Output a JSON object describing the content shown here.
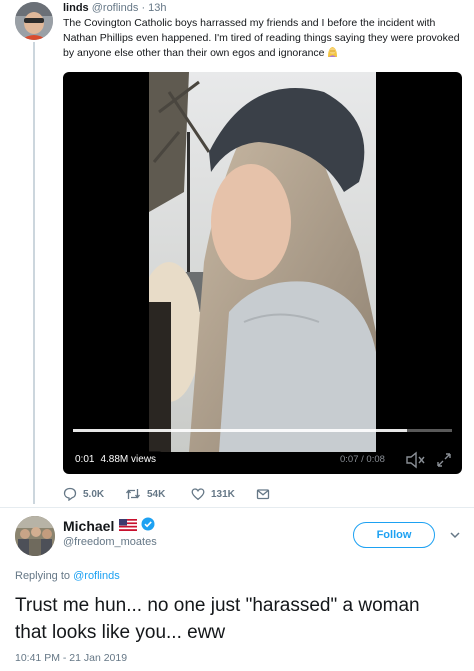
{
  "parent_tweet": {
    "name": "linds",
    "handle": "@roflinds",
    "separator": "·",
    "time": "13h",
    "text": "The Covington Catholic boys harrassed my friends and I before the incident with Nathan Phillips even happened. I'm tired of reading things saying they were provoked by anyone else other than their own egos and ignorance",
    "text_emoji": "woman-facepalming-emoji",
    "video": {
      "elapsed": "0:01",
      "views": "4.88M views",
      "duration": "0:07 / 0:08",
      "progress": 0.88
    },
    "actions": {
      "replies": "5.0K",
      "retweets": "54K",
      "likes": "131K",
      "reply_icon": "speech-bubble-icon",
      "retweet_icon": "retweet-icon",
      "like_icon": "heart-icon",
      "dm_icon": "envelope-icon"
    }
  },
  "reply_tweet": {
    "name": "Michael",
    "flag_icon": "us-flag-icon",
    "verified_icon": "verified-badge-icon",
    "handle": "@freedom_moates",
    "follow_label": "Follow",
    "replying_label": "Replying to",
    "replying_handle": "@roflinds",
    "text": "Trust me hun... no one just \"harassed\" a woman that looks like you... eww",
    "datetime": "10:41 PM - 21 Jan 2019"
  },
  "colors": {
    "accent": "#1da1f2",
    "muted_text": "#657786",
    "primary_text": "#14171a",
    "divider": "#e6ecf0"
  }
}
